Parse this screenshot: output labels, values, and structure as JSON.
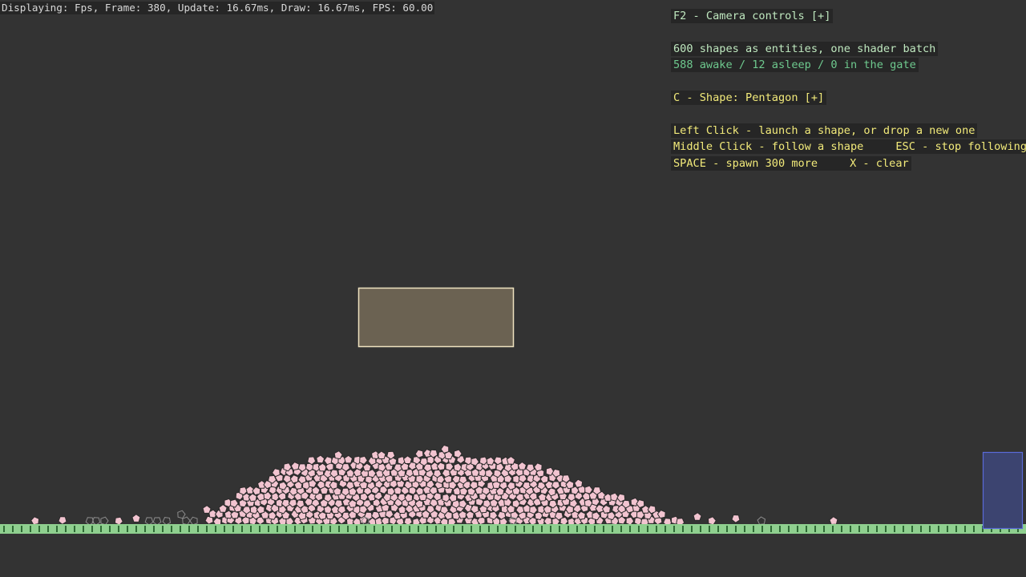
{
  "status_bar": {
    "text": "Displaying: Fps, Frame: 380, Update: 16.67ms, Draw: 16.67ms, FPS: 60.00"
  },
  "hud": {
    "camera_controls": "F2 - Camera controls [+]",
    "shapes_info": "600 shapes as entities, one shader batch",
    "sleep_info": "588 awake / 12 asleep / 0 in the gate",
    "shape_selector": "C - Shape: Pentagon [+]",
    "left_click_hint": "Left Click - launch a shape, or drop a new one",
    "middle_click_hint": "Middle Click - follow a shape",
    "esc_hint": "ESC - stop following",
    "space_hint": "SPACE - spawn 300 more",
    "clear_hint": "X - clear"
  },
  "world": {
    "shape": "pentagon",
    "shape_count_awake": 588,
    "shape_count_asleep": 12,
    "shape_count_in_gate": 0,
    "colors": {
      "background": "#333333",
      "shape_fill": "#f2c4d0",
      "shape_outline": "#2a2a2a",
      "sleeping_shape_outline": "#8c8c8c",
      "platform_fill": "#6b6252",
      "platform_border": "#efe3c0",
      "ground_fill": "#8fd08f",
      "ground_tooth": "#2f6a35",
      "gate_fill": "#3c4470",
      "gate_border": "#5a6ad8"
    }
  }
}
